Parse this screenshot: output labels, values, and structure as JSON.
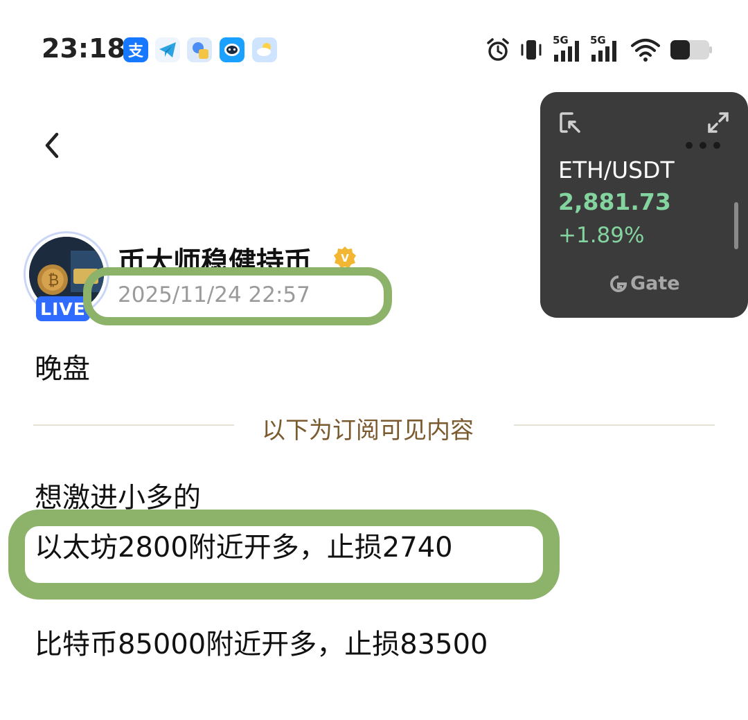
{
  "status_bar": {
    "time": "23:18",
    "apps": [
      {
        "icon": "alipay-icon",
        "glyph": "支",
        "color": "#1677ff"
      },
      {
        "icon": "telegram-icon",
        "glyph": "",
        "color": "#e8f2fb"
      },
      {
        "icon": "notes-app-icon",
        "glyph": "",
        "color": "#dbe9fb"
      },
      {
        "icon": "robot-app-icon",
        "glyph": "",
        "color": "#1aa0ff"
      },
      {
        "icon": "weather-icon",
        "glyph": "",
        "color": "#cfe4ff"
      }
    ],
    "network_1": "5G",
    "network_2": "5G"
  },
  "post": {
    "author": "币大师稳健持币",
    "verified_badge": "V",
    "live_label": "LIVE",
    "timestamp": "2025/11/24 22:57",
    "title": "晚盘",
    "divider_text": "以下为订阅可见内容",
    "lines": [
      "想激进小多的",
      "以太坊2800附近开多，止损2740",
      "比特币85000附近开多，止损83500"
    ]
  },
  "widget": {
    "pair": "ETH/USDT",
    "price": "2,881.73",
    "change": "+1.89%",
    "brand": "Gate"
  },
  "colors": {
    "highlight": "#8db36a",
    "price_up": "#84d4a0",
    "divider_text": "#7a5a2e",
    "live_badge": "#2f6bff",
    "widget_bg": "#3b3b3c"
  }
}
